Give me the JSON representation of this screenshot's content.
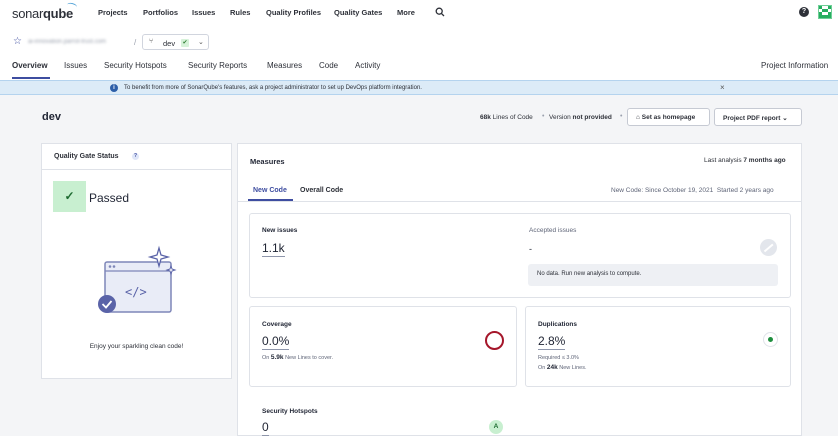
{
  "topnav": {
    "logo_prefix": "sonar",
    "logo_suffix": "qube",
    "items": [
      "Projects",
      "Portfolios",
      "Issues",
      "Rules",
      "Quality Profiles",
      "Quality Gates",
      "More"
    ],
    "help_icon": "question-circle-icon",
    "search_icon": "search-icon"
  },
  "project": {
    "name": "ai-innovation.parrot-trust.com",
    "separator": "/",
    "branch": "dev",
    "branch_status_icon": "check-icon"
  },
  "tabs": [
    "Overview",
    "Issues",
    "Security Hotspots",
    "Security Reports",
    "Measures",
    "Code",
    "Activity"
  ],
  "project_information": "Project Information",
  "banner": {
    "text": "To benefit from more of SonarQube's features, ask a project administrator to set up DevOps platform integration.",
    "close": "×"
  },
  "header": {
    "title": "dev",
    "loc_value": "68k",
    "loc_label": "Lines of Code",
    "version_label": "Version",
    "version_value": "not provided",
    "set_homepage": "Set as homepage",
    "pdf_report": "Project PDF report"
  },
  "quality_gate": {
    "title": "Quality Gate Status",
    "help": "?",
    "status": "Passed",
    "status_color": "#c8efd0",
    "message": "Enjoy your sparkling clean code!"
  },
  "measures": {
    "title": "Measures",
    "last_analysis_label": "Last analysis",
    "last_analysis_value": "7 months ago",
    "tabs": [
      "New Code",
      "Overall Code"
    ],
    "new_code_since": "New Code: Since October 19, 2021",
    "started": "Started 2 years ago",
    "new_issues_label": "New issues",
    "new_issues_value": "1.1k",
    "accepted_issues_label": "Accepted issues",
    "accepted_issues_value": "-",
    "no_data": "No data. Run new analysis to compute.",
    "coverage_label": "Coverage",
    "coverage_value": "0.0%",
    "coverage_sub_pre": "On",
    "coverage_sub_num": "5.9k",
    "coverage_sub_post": "New Lines to cover.",
    "duplications_label": "Duplications",
    "duplications_value": "2.8%",
    "duplications_required": "Required ≤ 3.0%",
    "duplications_sub_pre": "On",
    "duplications_sub_num": "24k",
    "duplications_sub_post": "New Lines.",
    "hotspots_label": "Security Hotspots",
    "hotspots_value": "0",
    "hotspots_grade": "A"
  }
}
